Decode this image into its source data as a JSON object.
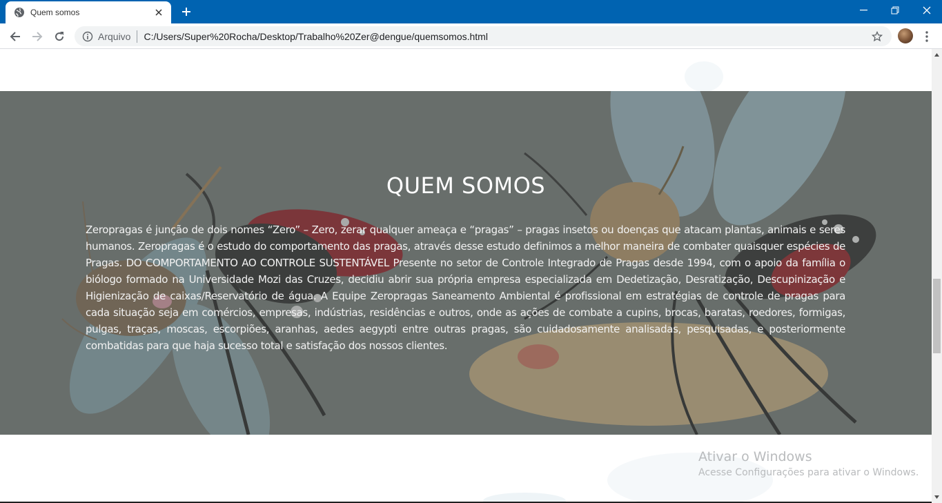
{
  "browser": {
    "tab": {
      "title": "Quem somos",
      "favicon": "globe-icon"
    },
    "new_tab_icon": "plus-icon",
    "window_controls": [
      "minimize-icon",
      "restore-icon",
      "close-icon"
    ],
    "nav": {
      "back_icon": "arrow-left-icon",
      "forward_icon": "arrow-right-icon",
      "reload_icon": "reload-icon"
    },
    "omnibox": {
      "security_icon": "info-icon",
      "scheme_label": "Arquivo",
      "url": "C:/Users/Super%20Rocha/Desktop/Trabalho%20Zer@dengue/quemsomos.html",
      "bookmark_icon": "star-icon"
    },
    "menu_icon": "kebab-menu-icon",
    "accent_color": "#0063b1"
  },
  "page": {
    "hero": {
      "title": "QUEM SOMOS",
      "text": "Zeropragas é junção de dois nomes “Zero” – Zero, zerar qualquer ameaça e “pragas” – pragas insetos ou doenças que atacam plantas, animais e seres humanos. Zeropragas é o estudo do comportamento das pragas, através desse estudo definimos a melhor maneira de combater quaisquer espécies de Pragas. DO COMPORTAMENTO AO CONTROLE SUSTENTÁVEL Presente no setor de Controle Integrado de Pragas desde 1994, com o apoio da família o biólogo formado na Universidade Mozi das Cruzes, decidiu abrir sua própria empresa especializada em Dedetização, Desratização, Descupinização e Higienização de caixas/Reservatório de água. A Equipe Zeropragas Saneamento Ambiental é profissional em estratégias de controle de pragas para cada situação seja em comércios, empresas, indústrias, residências e outros, onde as ações de combate a cupins, brocas, baratas, roedores, formigas, pulgas, traças, moscas, escorpiões, aranhas, aedes aegypti entre outras pragas, são cuidadosamente analisadas, pesquisadas, e posteriormente combatidas para que haja sucesso total e satisfação dos nossos clientes.",
      "background_image": "mosquito-illustration"
    }
  },
  "os_watermark": {
    "title": "Ativar o Windows",
    "subtitle": "Acesse Configurações para ativar o Windows."
  }
}
